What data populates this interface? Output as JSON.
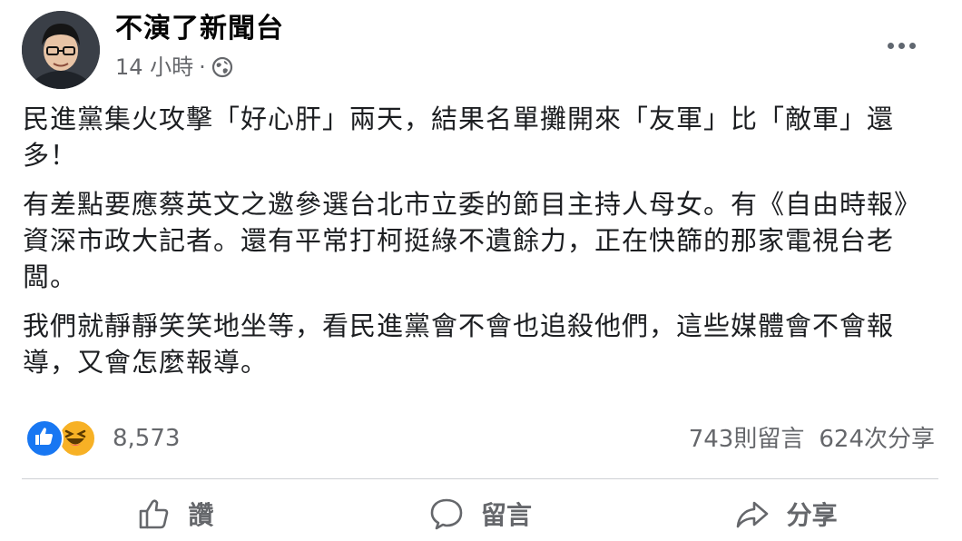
{
  "post": {
    "author": "不演了新聞台",
    "time": "14 小時",
    "separator": "·",
    "privacy_icon": "globe-icon",
    "paragraphs": [
      "民進黨集火攻擊「好心肝」兩天，結果名單攤開來「友軍」比「敵軍」還多！",
      "有差點要應蔡英文之邀參選台北市立委的節目主持人母女。有《自由時報》資深市政大記者。還有平常打柯挺綠不遺餘力，正在快篩的那家電視台老闆。",
      "我們就靜靜笑笑地坐等，看民進黨會不會也追殺他們，這些媒體會不會報導，又會怎麼報導。"
    ]
  },
  "engagement": {
    "reaction_count": "8,573",
    "comments": "743則留言",
    "shares": "624次分享"
  },
  "actions": {
    "like_label": "讚",
    "comment_label": "留言",
    "share_label": "分享"
  }
}
